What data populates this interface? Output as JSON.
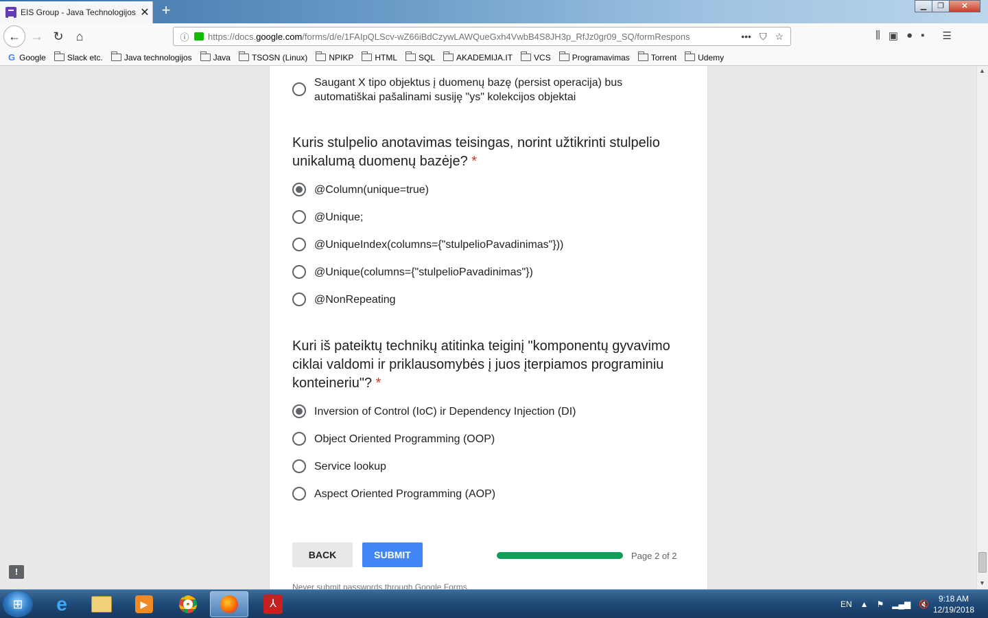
{
  "browser": {
    "tab_title": "EIS Group - Java Technologijos",
    "tab_close": "✕",
    "new_tab": "+",
    "url_prefix": "https://docs.",
    "url_domain": "google.com",
    "url_rest": "/forms/d/e/1FAIpQLScv-wZ66iBdCzywLAWQueGxh4VwbB4S8JH3p_RfJz0gr09_SQ/formRespons",
    "bookmarks": [
      "Google",
      "Slack etc.",
      "Java technologijos",
      "Java",
      "TSOSN (Linux)",
      "NPIKP",
      "HTML",
      "SQL",
      "AKADEMIJA.IT",
      "VCS",
      "Programavimas",
      "Torrent",
      "Udemy"
    ]
  },
  "form": {
    "prev_option": "Saugant X tipo objektus į duomenų bazę (persist operacija) bus automatiškai pašalinami susiję \"ys\" kolekcijos objektai",
    "q1": {
      "text": "Kuris stulpelio anotavimas teisingas, norint užtikrinti stulpelio unikalumą duomenų bazėje?",
      "required_mark": "*",
      "options": [
        "@Column(unique=true)",
        "@Unique;",
        "@UniqueIndex(columns={\"stulpelioPavadinimas\"}))",
        "@Unique(columns={\"stulpelioPavadinimas\"})",
        "@NonRepeating"
      ],
      "selected_index": 0
    },
    "q2": {
      "text": "Kuri iš pateiktų technikų atitinka teiginį \"komponentų gyvavimo ciklai valdomi ir priklausomybės į juos įterpiamos programiniu konteineriu\"?",
      "required_mark": "*",
      "options": [
        "Inversion of Control (IoC) ir Dependency Injection (DI)",
        "Object Oriented Programming (OOP)",
        "Service lookup",
        "Aspect Oriented Programming (AOP)"
      ],
      "selected_index": 0
    },
    "back_label": "BACK",
    "submit_label": "SUBMIT",
    "progress": 1.0,
    "page_label": "Page 2 of 2",
    "footer_note": "Never submit passwords through Google Forms."
  },
  "taskbar": {
    "lang": "EN",
    "time": "9:18 AM",
    "date": "12/19/2018"
  },
  "colors": {
    "submit": "#4285f4",
    "progress": "#0f9d58",
    "required": "#d93025"
  }
}
